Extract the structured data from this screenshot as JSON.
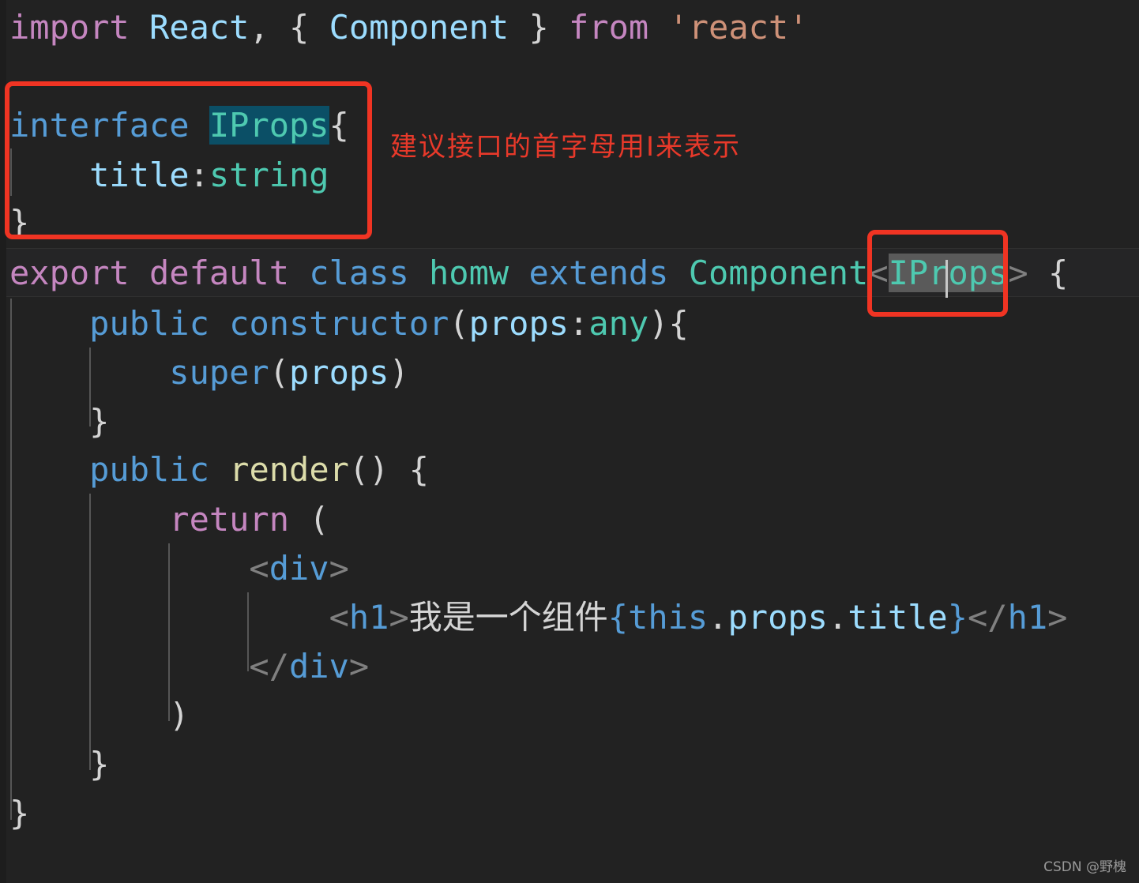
{
  "editor": {
    "theme": "dark-plus",
    "background": "#222222",
    "gutter_background": "#1d1d1d",
    "current_line_background": "#252526",
    "indent_guide_color": "#565656",
    "font_size_px": 42,
    "line_height_px": 63,
    "language": "TypeScript React"
  },
  "colors": {
    "keyword": "#c586c0",
    "storage": "#569cd6",
    "variable": "#9cdcfe",
    "type": "#4ec9b0",
    "string": "#ce9178",
    "punctuation": "#d4d4d4",
    "function": "#dcdcaa",
    "tag_punctuation": "#808080",
    "tag_name": "#569cd6",
    "annotation_red": "#f03423",
    "selection_teal": "#0b4f66",
    "selection_gray": "#5a5a5a",
    "caret": "#c8c8c8",
    "watermark": "#9a9a9a"
  },
  "code": {
    "line1": {
      "t1": "import",
      "t2": " React",
      "t3": ", ",
      "t4": "{ ",
      "t5": "Component",
      "t6": " }",
      "t7": " from",
      "t8": " 'react'"
    },
    "line3": {
      "t1": "interface",
      "t2": " ",
      "t3": "IProps",
      "t4": "{"
    },
    "line4": {
      "t1": "    title",
      "t2": ":",
      "t3": "string"
    },
    "line5": {
      "t1": "}"
    },
    "line6": {
      "t1": "export",
      "t2": " default",
      "t3": " class",
      "t4": " homw",
      "t5": " extends",
      "t6": " Component",
      "t7": "<",
      "t8": "IProps",
      "t9": ">",
      "t10": " {"
    },
    "line7": {
      "t1": "    public",
      "t2": " constructor",
      "t3": "(",
      "t4": "props",
      "t5": ":",
      "t6": "any",
      "t7": "){"
    },
    "line8": {
      "t1": "        super",
      "t2": "(",
      "t3": "props",
      "t4": ")"
    },
    "line9": {
      "t1": "    }"
    },
    "line10": {
      "t1": "    public",
      "t2": " ",
      "t3": "render",
      "t4": "() {"
    },
    "line11": {
      "t1": "        return",
      "t2": " ("
    },
    "line12": {
      "t1": "            <",
      "t2": "div",
      "t3": ">"
    },
    "line13": {
      "t1": "                <",
      "t2": "h1",
      "t3": ">",
      "t4": "我是一个组件",
      "t5": "{",
      "t6": "this",
      "t7": ".",
      "t8": "props",
      "t9": ".",
      "t10": "title",
      "t11": "}",
      "t12": "</",
      "t13": "h1",
      "t14": ">"
    },
    "line14": {
      "t1": "            </",
      "t2": "div",
      "t3": ">"
    },
    "line15": {
      "t1": "        )"
    },
    "line16": {
      "t1": "    }"
    },
    "line17": {
      "t1": "}"
    }
  },
  "annotations": {
    "interface_note": "建议接口的首字母用I来表示"
  },
  "watermark": {
    "text": "CSDN @野槐"
  }
}
